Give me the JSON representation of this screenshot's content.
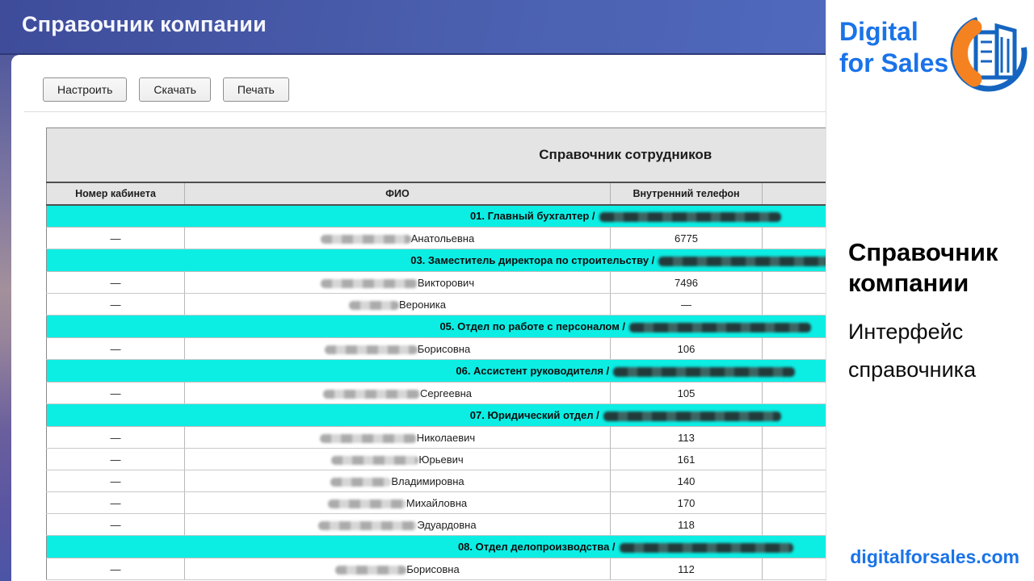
{
  "colors": {
    "cyan": "#0ceee4",
    "brand_blue": "#1a73e8"
  },
  "header": {
    "title": "Справочник компании"
  },
  "toolbar": {
    "configure_label": "Настроить",
    "download_label": "Скачать",
    "print_label": "Печать"
  },
  "table": {
    "title": "Справочник сотрудников",
    "columns": [
      "Номер кабинета",
      "ФИО",
      "Внутренний телефон",
      ""
    ],
    "rows": [
      {
        "type": "section",
        "label": "01. Главный бухгалтер /",
        "redacted_width": 225
      },
      {
        "type": "data",
        "room": "—",
        "name_redacted_width": 112,
        "name_suffix": "Анатольевна",
        "phone": "6775"
      },
      {
        "type": "section",
        "label": "03. Заместитель директора по строительству /",
        "redacted_width": 225
      },
      {
        "type": "data",
        "room": "—",
        "name_redacted_width": 120,
        "name_suffix": "Викторович",
        "phone": "7496"
      },
      {
        "type": "data",
        "room": "—",
        "name_redacted_width": 62,
        "name_suffix": "Вероника",
        "phone": "—"
      },
      {
        "type": "section",
        "label": "05. Отдел по работе с персоналом /",
        "redacted_width": 225
      },
      {
        "type": "data",
        "room": "—",
        "name_redacted_width": 115,
        "name_suffix": "Борисовна",
        "phone": "106"
      },
      {
        "type": "section",
        "label": "06. Ассистент руководителя /",
        "redacted_width": 225
      },
      {
        "type": "data",
        "room": "—",
        "name_redacted_width": 120,
        "name_suffix": "Сергеевна",
        "phone": "105"
      },
      {
        "type": "section",
        "label": "07. Юридический отдел /",
        "redacted_width": 220
      },
      {
        "type": "data",
        "room": "—",
        "name_redacted_width": 120,
        "name_suffix": "Николаевич",
        "phone": "113"
      },
      {
        "type": "data",
        "room": "—",
        "name_redacted_width": 108,
        "name_suffix": "Юрьевич",
        "phone": "161"
      },
      {
        "type": "data",
        "room": "—",
        "name_redacted_width": 75,
        "name_suffix": "Владимировна",
        "phone": "140"
      },
      {
        "type": "data",
        "room": "—",
        "name_redacted_width": 97,
        "name_suffix": "Михайловна",
        "phone": "170"
      },
      {
        "type": "data",
        "room": "—",
        "name_redacted_width": 122,
        "name_suffix": "Эдуардовна",
        "phone": "118"
      },
      {
        "type": "section",
        "label": "08. Отдел делопроизводства /",
        "redacted_width": 215
      },
      {
        "type": "data",
        "room": "—",
        "name_redacted_width": 88,
        "name_suffix": "Борисовна",
        "phone": "112"
      }
    ]
  },
  "side_panel": {
    "brand_line1": "Digital",
    "brand_line2": "for Sales",
    "heading": "Справочник компании",
    "subheading": "Интерфейс справочника",
    "website": "digitalforsales.com"
  }
}
